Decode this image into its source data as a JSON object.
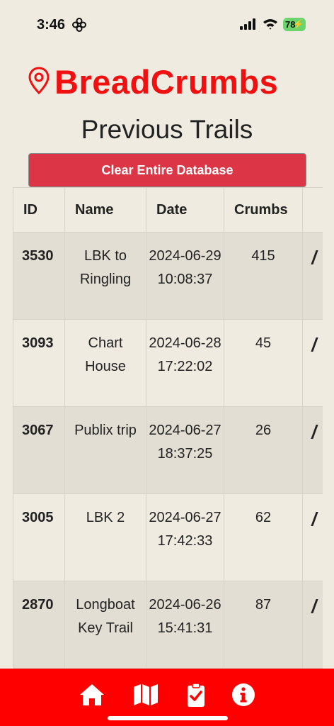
{
  "status": {
    "time": "3:46",
    "battery": "78"
  },
  "app": {
    "name": "BreadCrumbs",
    "page_title": "Previous Trails",
    "clear_button": "Clear Entire Database"
  },
  "table": {
    "headers": {
      "id": "ID",
      "name": "Name",
      "date": "Date",
      "crumbs": "Crumbs"
    },
    "rows": [
      {
        "id": "3530",
        "name": "LBK to Ringling",
        "date": "2024-06-29 10:08:37",
        "crumbs": "415"
      },
      {
        "id": "3093",
        "name": "Chart House",
        "date": "2024-06-28 17:22:02",
        "crumbs": "45"
      },
      {
        "id": "3067",
        "name": "Publix trip",
        "date": "2024-06-27 18:37:25",
        "crumbs": "26"
      },
      {
        "id": "3005",
        "name": "LBK 2",
        "date": "2024-06-27 17:42:33",
        "crumbs": "62"
      },
      {
        "id": "2870",
        "name": "Longboat Key Trail",
        "date": "2024-06-26 15:41:31",
        "crumbs": "87"
      }
    ]
  },
  "nav": {
    "icons": [
      "home-icon",
      "map-icon",
      "clipboard-check-icon",
      "info-icon"
    ]
  },
  "colors": {
    "brand_red": "#f01010",
    "button_red": "#dc3545",
    "nav_red": "#ff0000",
    "background": "#efebe1",
    "row_alt": "#e2ded3"
  }
}
